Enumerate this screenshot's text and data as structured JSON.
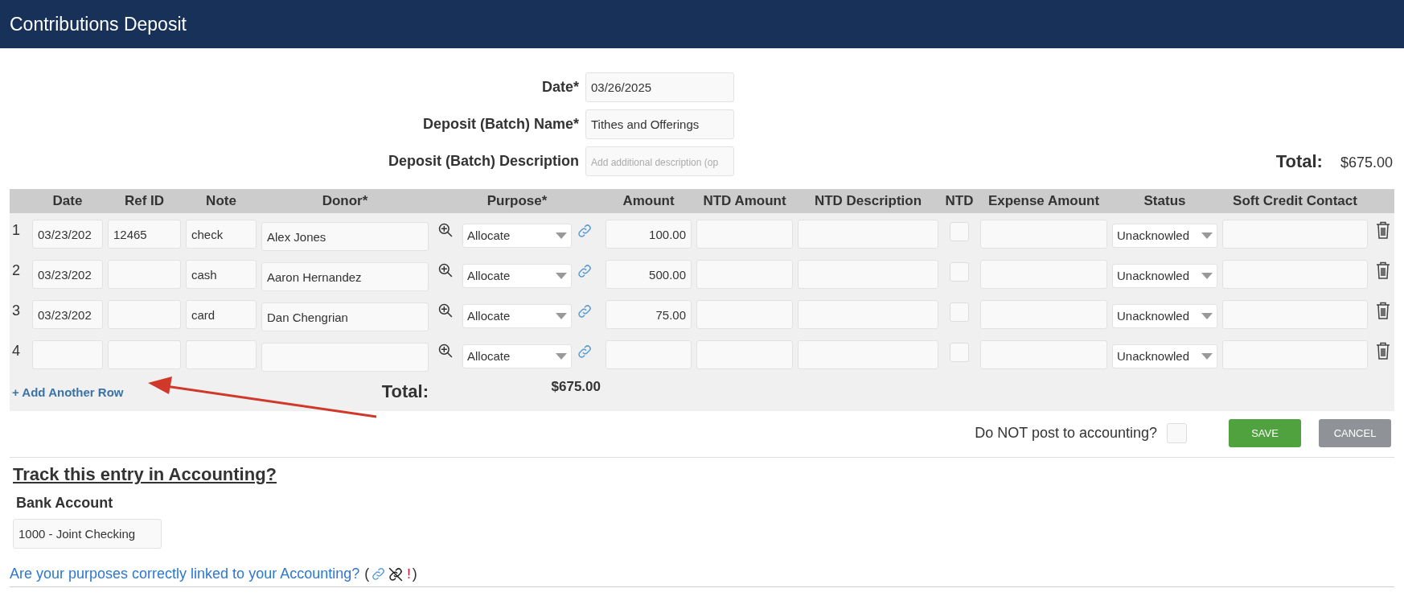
{
  "header": {
    "title": "Contributions Deposit"
  },
  "form": {
    "fields": [
      {
        "label": "Date*",
        "value": "03/26/2025"
      },
      {
        "label": "Deposit (Batch) Name*",
        "value": "Tithes and Offerings"
      },
      {
        "label": "Deposit (Batch) Description",
        "placeholder": "Add additional description (op"
      }
    ],
    "total": {
      "label": "Total:",
      "value": "$675.00"
    }
  },
  "table": {
    "columns": [
      "Date",
      "Ref ID",
      "Note",
      "Donor*",
      "Purpose*",
      "Amount",
      "NTD Amount",
      "NTD Description",
      "NTD",
      "Expense Amount",
      "Status",
      "Soft Credit Contact"
    ],
    "rows": [
      {
        "number": "1",
        "date": "03/23/202",
        "ref_id": "12465",
        "note": "check",
        "donor": "Alex Jones",
        "purpose": "Allocate",
        "amount": "100.00",
        "ntd": false,
        "status": "Unacknowled"
      },
      {
        "number": "2",
        "date": "03/23/202",
        "note": "cash",
        "donor": "Aaron Hernandez",
        "purpose": "Allocate",
        "amount": "500.00",
        "ntd": false,
        "status": "Unacknowled"
      },
      {
        "number": "3",
        "date": "03/23/202",
        "note": "card",
        "donor": "Dan Chengrian",
        "purpose": "Allocate",
        "amount": "75.00",
        "ntd": false,
        "status": "Unacknowled"
      },
      {
        "number": "4",
        "purpose": "Allocate",
        "ntd": false,
        "status": "Unacknowled"
      }
    ],
    "add_row": "+ Add Another Row",
    "total": {
      "label": "Total:",
      "value": "$675.00"
    }
  },
  "post_option": {
    "label": "Do NOT post to accounting?",
    "checked": false
  },
  "buttons": [
    {
      "label": "SAVE",
      "kind": "save"
    },
    {
      "label": "CANCEL",
      "kind": "cancel"
    }
  ],
  "accounting": {
    "title": "Track this entry in Accounting?",
    "bank_account_label": "Bank Account",
    "bank_account_value": "1000 - Joint Checking",
    "link_text": "Are your purposes correctly linked to your Accounting?",
    "open_paren": "(",
    "warning_mark": "!",
    "close_paren": ")"
  }
}
